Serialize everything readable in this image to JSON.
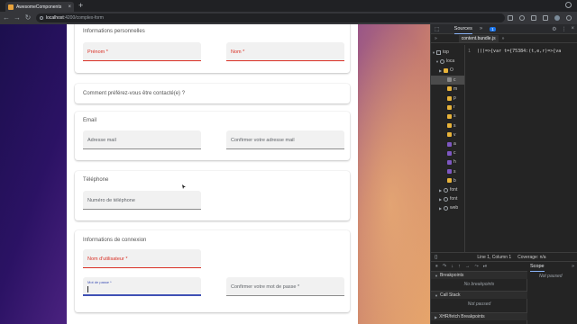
{
  "browser": {
    "tab_title": "AwesomeComponents",
    "tab_close": "×",
    "new_tab": "+",
    "url_host": "localhost",
    "url_path": ":4200/complex-form",
    "nav": {
      "back": "←",
      "forward": "→",
      "reload": "↻"
    }
  },
  "form": {
    "sections": [
      {
        "title": "Informations personnelles",
        "fields": [
          {
            "label": "Prénom *",
            "state": "error"
          },
          {
            "label": "Nom *",
            "state": "error"
          }
        ]
      },
      {
        "title": "Comment préférez-vous être contacté(e) ?",
        "fields": []
      },
      {
        "title": "Email",
        "fields": [
          {
            "label": "Adresse mail",
            "state": "default"
          },
          {
            "label": "Confirmer votre adresse mail",
            "state": "default"
          }
        ]
      },
      {
        "title": "Téléphone",
        "fields": [
          {
            "label": "Numéro de téléphone",
            "state": "default"
          }
        ]
      },
      {
        "title": "Informations de connexion",
        "fields": [
          {
            "label": "Nom d'utilisateur *",
            "state": "error"
          },
          {
            "label": "Mot de passe *",
            "state": "focused"
          },
          {
            "label": "Confirmer votre mot de passe *",
            "state": "default"
          }
        ]
      }
    ]
  },
  "devtools": {
    "tabs": {
      "sources": "Sources",
      "more": "»",
      "badge": "1"
    },
    "sub": {
      "chev": "»",
      "file": "content.bundle.js",
      "more": "»"
    },
    "tree": [
      {
        "tri": "▼",
        "icon": "box",
        "label": "top"
      },
      {
        "tri": "▼",
        "icon": "cloud",
        "label": "loca"
      },
      {
        "tri": "▶",
        "icon": "folder",
        "label": "O"
      },
      {
        "tri": "",
        "icon": "grey",
        "label": "c"
      },
      {
        "tri": "",
        "icon": "folder",
        "label": "m"
      },
      {
        "tri": "",
        "icon": "folder",
        "label": "p"
      },
      {
        "tri": "",
        "icon": "folder",
        "label": "r"
      },
      {
        "tri": "",
        "icon": "folder",
        "label": "s"
      },
      {
        "tri": "",
        "icon": "folder",
        "label": "s"
      },
      {
        "tri": "",
        "icon": "folder",
        "label": "v"
      },
      {
        "tri": "",
        "icon": "purple",
        "label": "a"
      },
      {
        "tri": "",
        "icon": "purple",
        "label": "c"
      },
      {
        "tri": "",
        "icon": "purple",
        "label": "h"
      },
      {
        "tri": "",
        "icon": "purple",
        "label": "s"
      },
      {
        "tri": "",
        "icon": "folder",
        "label": "b"
      },
      {
        "tri": "▶",
        "icon": "cloud",
        "label": "font"
      },
      {
        "tri": "▶",
        "icon": "cloud",
        "label": "font"
      },
      {
        "tri": "▶",
        "icon": "cloud",
        "label": "web"
      }
    ],
    "code": {
      "line_number": "1",
      "text": "(()=>{var t={75384:(t,e,r)=>{va"
    },
    "status": {
      "brace": "{}",
      "position": "Line 1, Column 1",
      "coverage": "Coverage: n/a"
    },
    "debugger": {
      "scope_tab": "Scope",
      "more": "»"
    },
    "sections": {
      "breakpoints": "Breakpoints",
      "no_breakpoints": "No breakpoints",
      "call_stack": "Call Stack",
      "not_paused": "Not paused",
      "xhr": "XHR/fetch Breakpoints"
    },
    "scope_msg": "Not paused"
  }
}
